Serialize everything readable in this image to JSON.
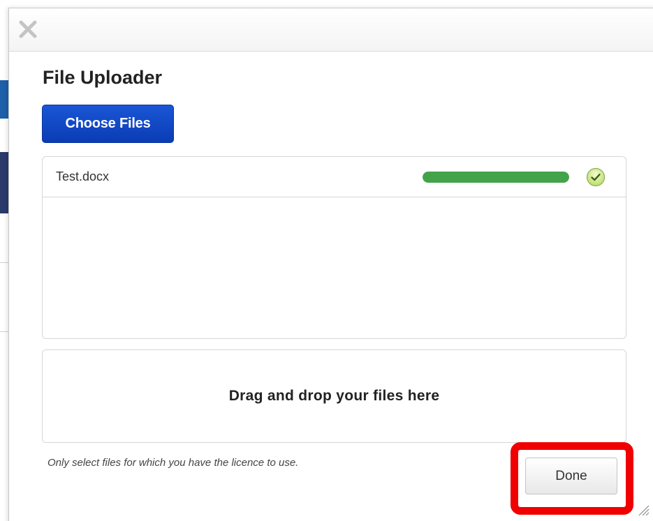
{
  "dialog": {
    "close_icon": "close-icon",
    "title": "File Uploader",
    "choose_files_label": "Choose Files",
    "files": [
      {
        "name": "Test.docx",
        "progress_percent": 100,
        "status_icon": "check-circle-icon",
        "progress_color": "#43a34a"
      }
    ],
    "dropzone_text": "Drag and drop your files here",
    "licence_note": "Only select files for which you have the licence to use.",
    "done_label": "Done",
    "accent_color": "#0a3cb4",
    "highlight_color": "#f00000"
  }
}
